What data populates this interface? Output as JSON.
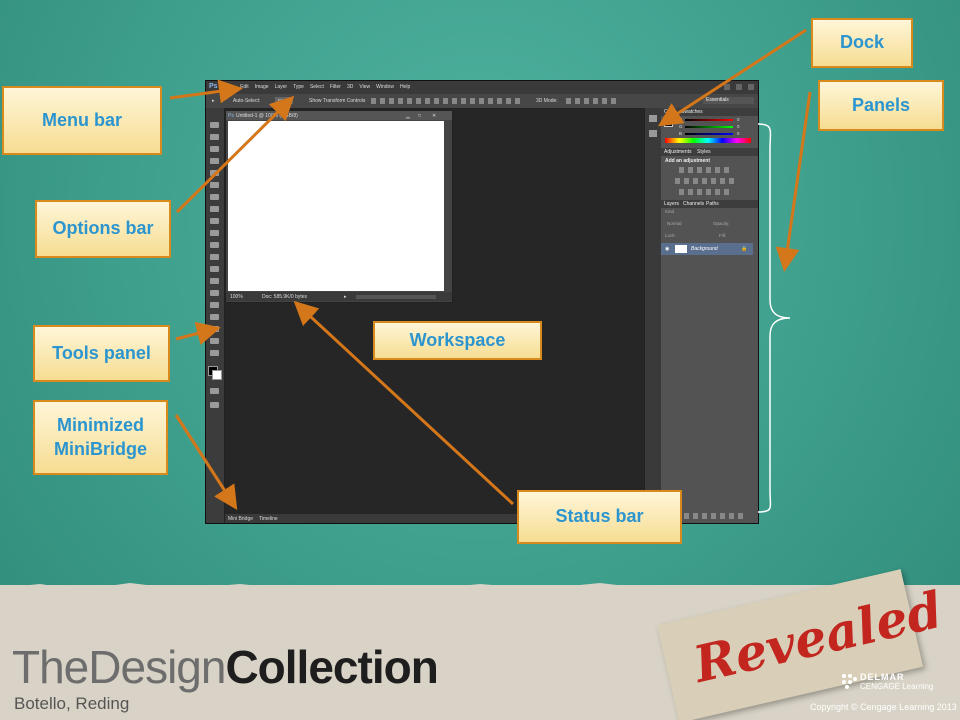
{
  "callouts": {
    "dock": "Dock",
    "panels": "Panels",
    "menu_bar": "Menu bar",
    "options_bar": "Options bar",
    "tools_panel": "Tools panel",
    "minimized_minibridge": "Minimized MiniBridge",
    "workspace": "Workspace",
    "status_bar": "Status bar"
  },
  "photoshop": {
    "logo": "Ps",
    "menu_items": [
      "File",
      "Edit",
      "Image",
      "Layer",
      "Type",
      "Select",
      "Filter",
      "3D",
      "View",
      "Window",
      "Help"
    ],
    "options": {
      "auto_select": "Auto-Select:",
      "group": "Group",
      "show_transform": "Show Transform Controls",
      "mode_3d": "3D Mode:",
      "essentials": "Essentials"
    },
    "document": {
      "title": "Untitled-1 @ 100% (RGB/8)",
      "zoom": "100%",
      "doc_size": "Doc: 585.9K/0 bytes"
    },
    "panels": {
      "color_tab": "Color",
      "swatches_tab": "Swatches",
      "rgb_labels": [
        "R",
        "G",
        "B"
      ],
      "rgb_values": [
        "0",
        "0",
        "0"
      ],
      "adjustments_tab": "Adjustments",
      "styles_tab": "Styles",
      "add_adjustment": "Add an adjustment",
      "layers_tab": "Layers",
      "channels_tab": "Channels",
      "paths_tab": "Paths",
      "kind": "Kind",
      "blend_mode": "Normal",
      "opacity": "Opacity:",
      "lock": "Lock:",
      "fill": "Fill:",
      "layer_name": "Background"
    },
    "bottom_tabs": [
      "Mini Bridge",
      "Timeline"
    ]
  },
  "branding": {
    "title_light": "TheDesign",
    "title_bold": "Collection",
    "authors": "Botello, Reding",
    "revealed": "Revealed",
    "publisher_line1": "DELMAR",
    "publisher_line2": "CENGAGE Learning",
    "copyright": "Copyright © Cengage Learning 2013"
  },
  "colors": {
    "slide_background": "#3d9e8b",
    "callout_border": "#d98a1c",
    "callout_text": "#2c95cf",
    "arrow": "#d4761a"
  }
}
